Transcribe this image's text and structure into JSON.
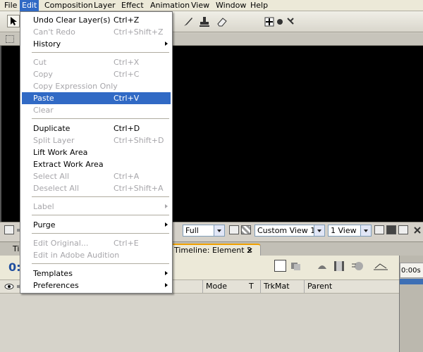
{
  "menubar": [
    "File",
    "Edit",
    "Composition",
    "Layer",
    "Effect",
    "Animation",
    "View",
    "Window",
    "Help"
  ],
  "edit_menu": {
    "undo": {
      "label": "Undo Clear Layer(s)",
      "shortcut": "Ctrl+Z"
    },
    "redo": {
      "label": "Can't Redo",
      "shortcut": "Ctrl+Shift+Z"
    },
    "history": {
      "label": "History"
    },
    "cut": {
      "label": "Cut",
      "shortcut": "Ctrl+X"
    },
    "copy": {
      "label": "Copy",
      "shortcut": "Ctrl+C"
    },
    "copy_expression": {
      "label": "Copy Expression Only"
    },
    "paste": {
      "label": "Paste",
      "shortcut": "Ctrl+V"
    },
    "clear": {
      "label": "Clear"
    },
    "duplicate": {
      "label": "Duplicate",
      "shortcut": "Ctrl+D"
    },
    "split_layer": {
      "label": "Split Layer",
      "shortcut": "Ctrl+Shift+D"
    },
    "lift_work_area": {
      "label": "Lift Work Area"
    },
    "extract_work_area": {
      "label": "Extract Work Area"
    },
    "select_all": {
      "label": "Select All",
      "shortcut": "Ctrl+A"
    },
    "deselect_all": {
      "label": "Deselect All",
      "shortcut": "Ctrl+Shift+A"
    },
    "label": {
      "label": "Label"
    },
    "purge": {
      "label": "Purge"
    },
    "edit_original": {
      "label": "Edit Original...",
      "shortcut": "Ctrl+E"
    },
    "edit_audition": {
      "label": "Edit in Adobe Audition"
    },
    "templates": {
      "label": "Templates"
    },
    "preferences": {
      "label": "Preferences"
    }
  },
  "comp_panel": {
    "resolution": "Full",
    "view": "Custom View 1",
    "views_count": "1 View"
  },
  "timeline": {
    "tab_label": "Timeline: Element 2",
    "tab_close": "×",
    "tab_left_partial": "Ti",
    "timecode_partial": "0:",
    "ruler_start": "0:00s",
    "columns": [
      "Mode",
      "T",
      "TrkMat",
      "Parent"
    ]
  },
  "colors": {
    "highlight": "#316ac5",
    "timecode": "#1f4e9f",
    "tab_accent": "#f0a000"
  }
}
